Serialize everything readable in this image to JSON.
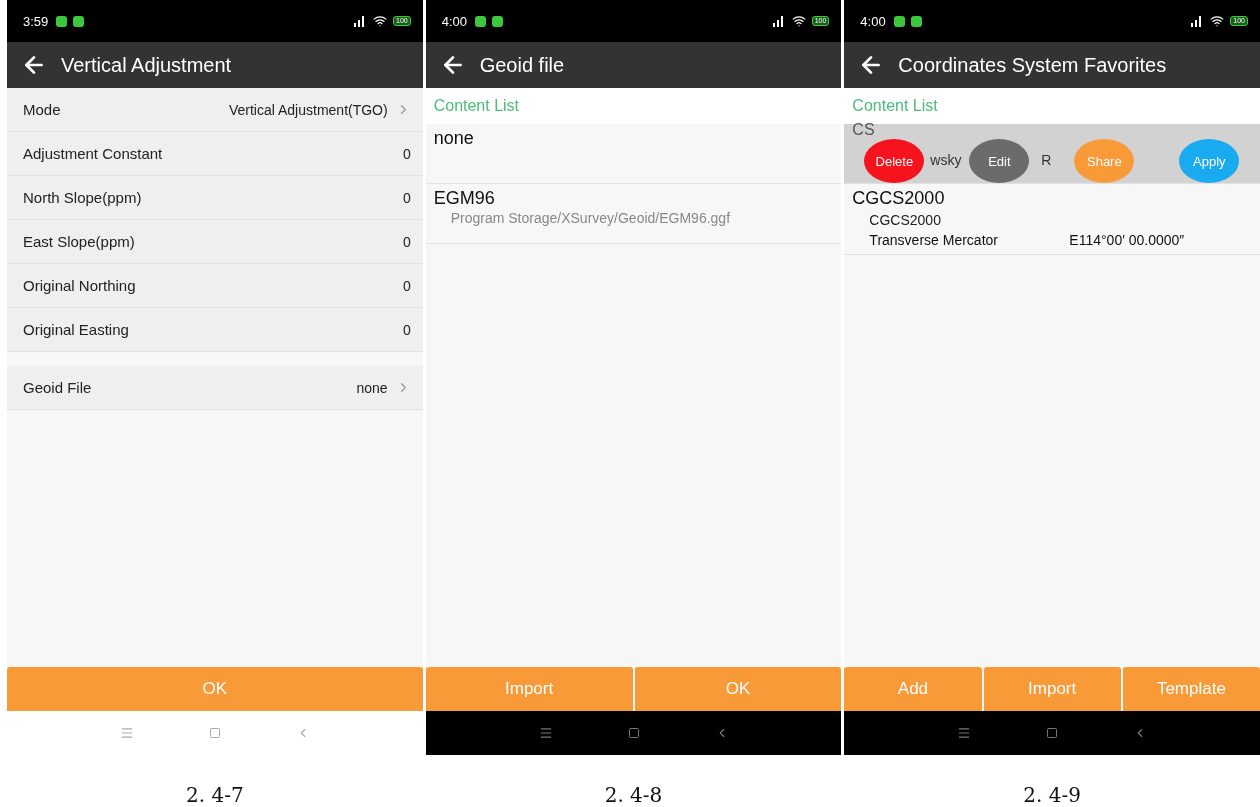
{
  "screens": [
    {
      "kind": "settings",
      "status": {
        "time": "3:59",
        "battery": "100"
      },
      "title": "Vertical Adjustment",
      "groups": [
        [
          {
            "label": "Mode",
            "value": "Vertical Adjustment(TGO)",
            "chevron": true
          },
          {
            "label": "Adjustment Constant",
            "value": "0",
            "chevron": false
          },
          {
            "label": "North Slope(ppm)",
            "value": "0",
            "chevron": false
          },
          {
            "label": "East Slope(ppm)",
            "value": "0",
            "chevron": false
          },
          {
            "label": "Original Northing",
            "value": "0",
            "chevron": false
          },
          {
            "label": "Original Easting",
            "value": "0",
            "chevron": false
          }
        ],
        [
          {
            "label": "Geoid File",
            "value": "none",
            "chevron": true
          }
        ]
      ],
      "buttons": [
        "OK"
      ],
      "dark_nav": false,
      "caption": "2. 4-7"
    },
    {
      "kind": "list",
      "status": {
        "time": "4:00",
        "battery": "100"
      },
      "title": "Geoid file",
      "list_header": "Content List",
      "items": [
        {
          "title": "none",
          "swiped": false
        },
        {
          "title": "EGM96",
          "subtitle": "Program Storage/XSurvey/Geoid/EGM96.ggf",
          "swiped": false
        }
      ],
      "buttons": [
        "Import",
        "OK"
      ],
      "dark_nav": true,
      "caption": "2. 4-8"
    },
    {
      "kind": "list",
      "status": {
        "time": "4:00",
        "battery": "100"
      },
      "title": "Coordinates System Favorites",
      "list_header": "Content List",
      "items": [
        {
          "title": "CS",
          "subtitle": "wsky",
          "subtitle_2": "R",
          "swiped": true,
          "actions": [
            {
              "label": "Delete",
              "color": "#f5141e"
            },
            {
              "label": "Edit",
              "color": "#6b6b6b"
            },
            {
              "label": "Share",
              "color": "#f99a38"
            },
            {
              "label": "Apply",
              "color": "#1aaaf0"
            }
          ]
        },
        {
          "title": "CGCS2000",
          "subtitle": "CGCS2000",
          "detail": "Transverse Mercator",
          "detail_2": "E114°00′ 00.0000″",
          "swiped": false
        }
      ],
      "buttons": [
        "Add",
        "Import",
        "Template"
      ],
      "dark_nav": true,
      "caption": "2. 4-9"
    }
  ]
}
